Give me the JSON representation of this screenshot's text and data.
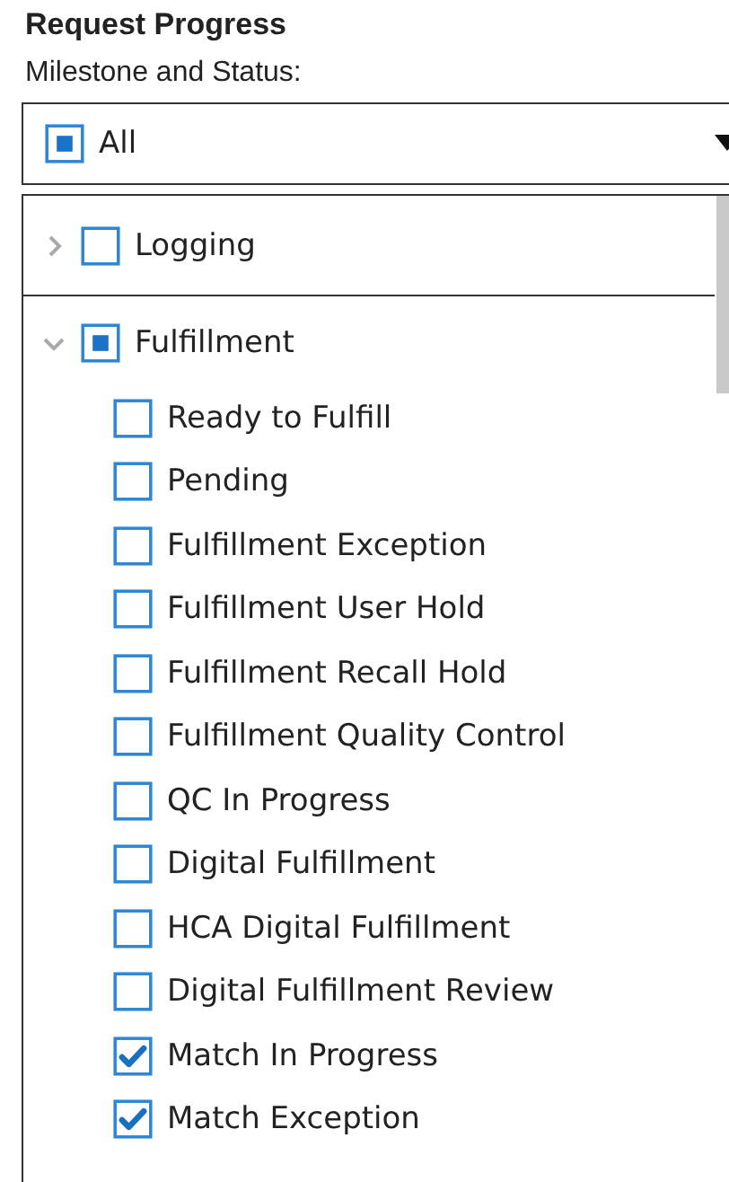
{
  "title": "Request Progress",
  "field_label": "Milestone and Status:",
  "dropdown": {
    "value": "All",
    "checked": false,
    "partial": true,
    "expanded": true
  },
  "items": [
    {
      "label": "Logging",
      "checked": false,
      "partial": false,
      "expanded": false
    },
    {
      "label": "Fulfillment",
      "checked": false,
      "partial": true,
      "expanded": true,
      "children": [
        {
          "label": "Ready to Fulfill",
          "checked": false
        },
        {
          "label": "Pending",
          "checked": false
        },
        {
          "label": "Fulfillment Exception",
          "checked": false
        },
        {
          "label": "Fulfillment User Hold",
          "checked": false
        },
        {
          "label": "Fulfillment Recall Hold",
          "checked": false
        },
        {
          "label": "Fulfillment Quality Control",
          "checked": false
        },
        {
          "label": "QC In Progress",
          "checked": false
        },
        {
          "label": "Digital Fulfillment",
          "checked": false
        },
        {
          "label": "HCA Digital Fulfillment",
          "checked": false
        },
        {
          "label": "Digital Fulfillment Review",
          "checked": false
        },
        {
          "label": "Match In Progress",
          "checked": true
        },
        {
          "label": "Match Exception",
          "checked": true
        }
      ]
    }
  ]
}
